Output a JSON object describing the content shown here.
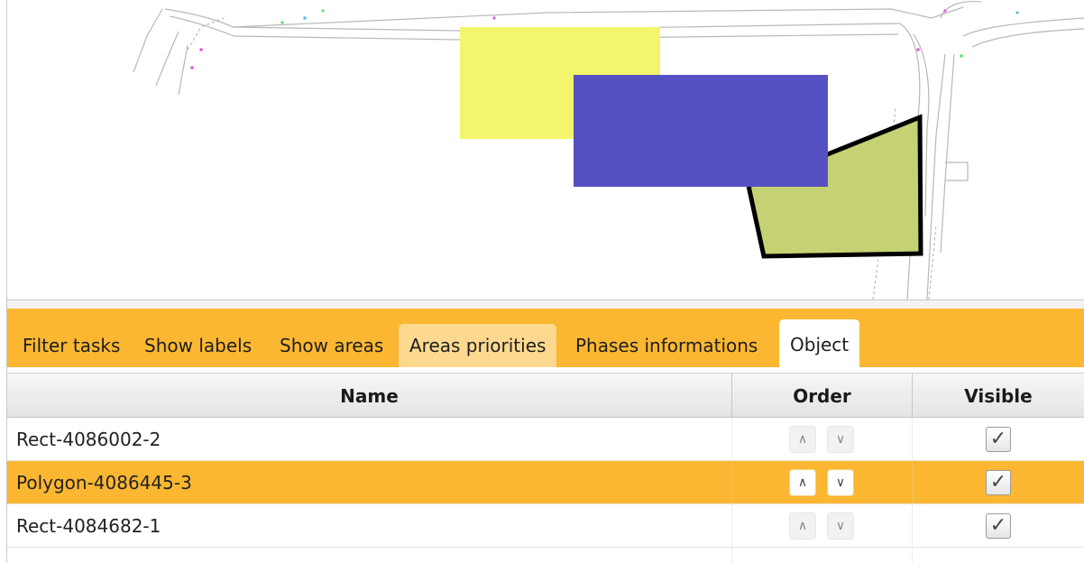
{
  "map": {
    "shapes": [
      {
        "name": "Rect-4084682-1",
        "kind": "rect",
        "fill": "#f3f56c"
      },
      {
        "name": "Rect-4086002-2",
        "kind": "rect",
        "fill": "#5551c2"
      },
      {
        "name": "Polygon-4086445-3",
        "kind": "polygon",
        "fill": "#c6d173",
        "stroke": "#000000"
      }
    ]
  },
  "tabs": [
    {
      "label": "Filter tasks",
      "state": "normal"
    },
    {
      "label": "Show labels",
      "state": "normal"
    },
    {
      "label": "Show areas",
      "state": "normal"
    },
    {
      "label": "Areas priorities",
      "state": "hover"
    },
    {
      "label": "Phases informations",
      "state": "normal"
    },
    {
      "label": "Object",
      "state": "active"
    }
  ],
  "table": {
    "headers": {
      "name": "Name",
      "order": "Order",
      "visible": "Visible"
    },
    "rows": [
      {
        "name": "Rect-4086002-2",
        "up": "∧",
        "down": "∨",
        "visible": true,
        "selected": false
      },
      {
        "name": "Polygon-4086445-3",
        "up": "∧",
        "down": "∨",
        "visible": true,
        "selected": true
      },
      {
        "name": "Rect-4084682-1",
        "up": "∧",
        "down": "∨",
        "visible": true,
        "selected": false
      }
    ],
    "check_glyph": "✓"
  },
  "colors": {
    "accent": "#fbb732",
    "tab_hover": "#fdd98f",
    "selected_row": "#fbb732"
  }
}
